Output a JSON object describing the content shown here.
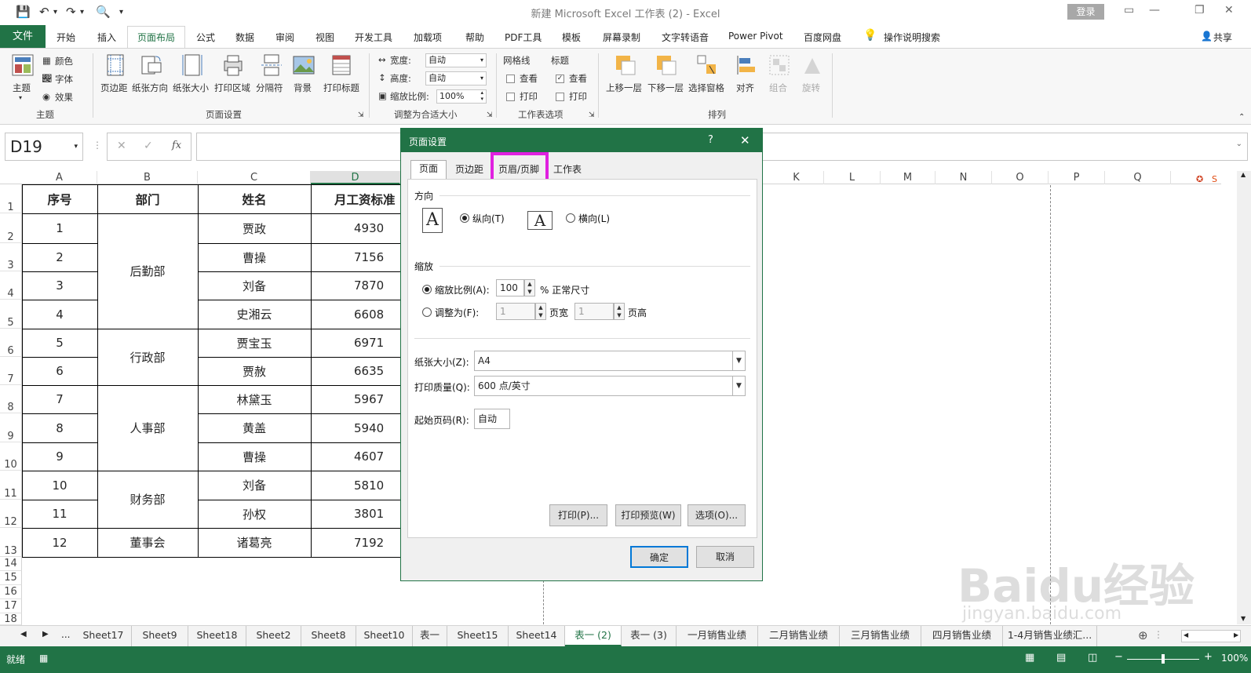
{
  "window": {
    "title": "新建 Microsoft Excel 工作表 (2)  -  Excel",
    "login": "登录",
    "share": "共享"
  },
  "menu": {
    "file": "文件",
    "tabs": [
      "开始",
      "插入",
      "页面布局",
      "公式",
      "数据",
      "审阅",
      "视图",
      "开发工具",
      "加载项",
      "帮助",
      "PDF工具",
      "模板",
      "屏幕录制",
      "文字转语音",
      "Power Pivot",
      "百度网盘"
    ],
    "active": "页面布局",
    "tell_me": "操作说明搜索"
  },
  "ribbon": {
    "theme_group": {
      "theme": "主题",
      "colors": "颜色",
      "fonts": "字体",
      "effects": "效果",
      "label": "主题"
    },
    "page_setup_group": {
      "margins": "页边距",
      "orientation": "纸张方向",
      "size": "纸张大小",
      "print_area": "打印区域",
      "breaks": "分隔符",
      "background": "背景",
      "print_titles": "打印标题",
      "label": "页面设置"
    },
    "scale_group": {
      "width_label": "宽度:",
      "width": "自动",
      "height_label": "高度:",
      "height": "自动",
      "scale_label": "缩放比例:",
      "scale": "100%",
      "label": "调整为合适大小"
    },
    "sheet_options_group": {
      "gridlines": "网格线",
      "headings": "标题",
      "view1": "查看",
      "view2": "查看",
      "print1": "打印",
      "print2": "打印",
      "label": "工作表选项"
    },
    "arrange_group": {
      "bring_forward": "上移一层",
      "send_backward": "下移一层",
      "selection_pane": "选择窗格",
      "align": "对齐",
      "group": "组合",
      "rotate": "旋转",
      "label": "排列"
    }
  },
  "formula_bar": {
    "name_box": "D19",
    "fx": "fx",
    "cancel": "✕",
    "enter": "✓"
  },
  "columns": [
    "A",
    "B",
    "C",
    "D",
    "K",
    "L",
    "M",
    "N",
    "O",
    "P",
    "Q"
  ],
  "rows": [
    "1",
    "2",
    "3",
    "4",
    "5",
    "6",
    "7",
    "8",
    "9",
    "10",
    "11",
    "12",
    "13",
    "14",
    "15",
    "16",
    "17",
    "18"
  ],
  "table": {
    "headers": [
      "序号",
      "部门",
      "姓名",
      "月工资标准"
    ],
    "depts": [
      "后勤部",
      "行政部",
      "人事部",
      "财务部",
      "董事会"
    ],
    "seq": [
      "1",
      "2",
      "3",
      "4",
      "5",
      "6",
      "7",
      "8",
      "9",
      "10",
      "11",
      "12"
    ],
    "names": [
      "贾政",
      "曹操",
      "刘备",
      "史湘云",
      "贾宝玉",
      "贾赦",
      "林黛玉",
      "黄盖",
      "曹操",
      "刘备",
      "孙权",
      "诸葛亮"
    ],
    "salaries": [
      "4930",
      "7156",
      "7870",
      "6608",
      "6971",
      "6635",
      "5967",
      "5940",
      "4607",
      "5810",
      "3801",
      "7192"
    ]
  },
  "dialog": {
    "title": "页面设置",
    "help": "?",
    "close": "✕",
    "tabs": [
      "页面",
      "页边距",
      "页眉/页脚",
      "工作表"
    ],
    "highlight_color": "#e020e0",
    "orientation_label": "方向",
    "portrait": "纵向(T)",
    "landscape": "横向(L)",
    "scaling_label": "缩放",
    "adjust_to": "缩放比例(A):",
    "adjust_value": "100",
    "normal_size": "% 正常尺寸",
    "fit_to": "调整为(F):",
    "fit_wide": "1",
    "pages_wide": "页宽",
    "fit_tall": "1",
    "pages_tall": "页高",
    "paper_size_label": "纸张大小(Z):",
    "paper_size": "A4",
    "print_quality_label": "打印质量(Q):",
    "print_quality": "600 点/英寸",
    "first_page_label": "起始页码(R):",
    "first_page": "自动",
    "print_btn": "打印(P)...",
    "preview_btn": "打印预览(W)",
    "options_btn": "选项(O)...",
    "ok": "确定",
    "cancel": "取消"
  },
  "sheets": [
    "Sheet17",
    "Sheet9",
    "Sheet18",
    "Sheet2",
    "Sheet8",
    "Sheet10",
    "表一",
    "Sheet15",
    "Sheet14",
    "表一 (2)",
    "表一 (3)",
    "一月销售业绩",
    "二月销售业绩",
    "三月销售业绩",
    "四月销售业绩",
    "1-4月销售业绩汇..."
  ],
  "active_sheet": "表一 (2)",
  "status": {
    "ready": "就绪",
    "zoom": "100%"
  },
  "watermark": "Baidu经验",
  "watermark_url": "jingyan.baidu.com",
  "colors": {
    "excel_green": "#217346"
  }
}
